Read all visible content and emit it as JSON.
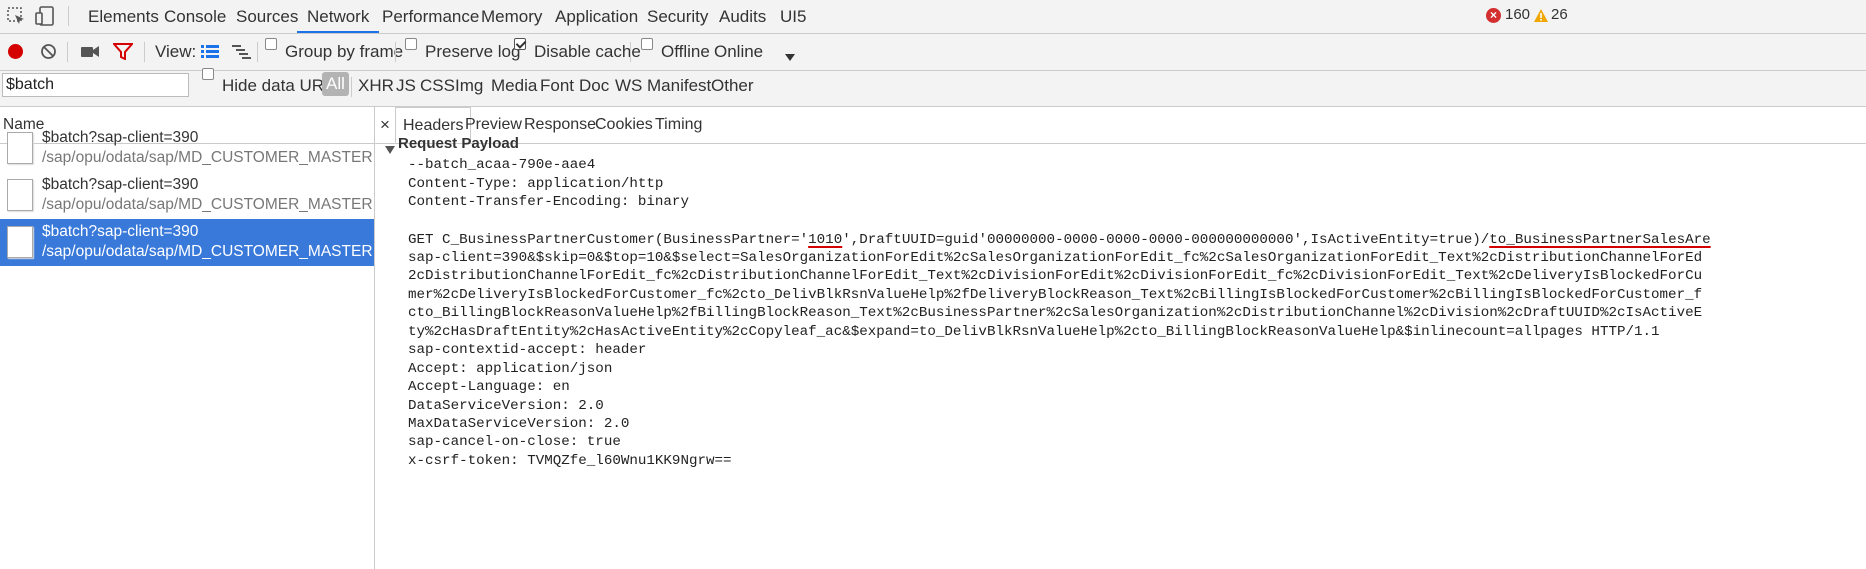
{
  "topbar": {
    "tabs": [
      "Elements",
      "Console",
      "Sources",
      "Network",
      "Performance",
      "Memory",
      "Application",
      "Security",
      "Audits",
      "UI5"
    ],
    "active_tab": "Network",
    "error_count": "160",
    "warning_count": "26"
  },
  "toolbar": {
    "view_label": "View:",
    "group_by_frame": "Group by frame",
    "preserve_log": "Preserve log",
    "disable_cache": "Disable cache",
    "offline": "Offline",
    "throttle_value": "Online"
  },
  "filterbar": {
    "filter_value": "$batch",
    "hide_data_urls": "Hide data URLs",
    "types": [
      "All",
      "XHR",
      "JS",
      "CSS",
      "Img",
      "Media",
      "Font",
      "Doc",
      "WS",
      "Manifest",
      "Other"
    ]
  },
  "requests": {
    "header": "Name",
    "items": [
      {
        "name": "$batch?sap-client=390",
        "path": "/sap/opu/odata/sap/MD_CUSTOMER_MASTER_SRV..."
      },
      {
        "name": "$batch?sap-client=390",
        "path": "/sap/opu/odata/sap/MD_CUSTOMER_MASTER_SRV..."
      },
      {
        "name": "$batch?sap-client=390",
        "path": "/sap/opu/odata/sap/MD_CUSTOMER_MASTER_SRV..."
      }
    ]
  },
  "details": {
    "close": "×",
    "tabs": [
      "Headers",
      "Preview",
      "Response",
      "Cookies",
      "Timing"
    ],
    "active_tab": "Headers",
    "section_title": "Request Payload",
    "payload": {
      "l1": "--batch_acaa-790e-aae4",
      "l2": "Content-Type: application/http",
      "l3": "Content-Transfer-Encoding: binary",
      "get_prefix": "GET C_BusinessPartnerCustomer(BusinessPartner='",
      "get_key": "1010",
      "get_mid": "',DraftUUID=guid'00000000-0000-0000-0000-000000000000',IsActiveEntity=true)/",
      "get_nav": "to_BusinessPartnerSalesAre",
      "l5": "sap-client=390&$skip=0&$top=10&$select=SalesOrganizationForEdit%2cSalesOrganizationForEdit_fc%2cSalesOrganizationForEdit_Text%2cDistributionChannelForEd",
      "l6": "2cDistributionChannelForEdit_fc%2cDistributionChannelForEdit_Text%2cDivisionForEdit%2cDivisionForEdit_fc%2cDivisionForEdit_Text%2cDeliveryIsBlockedForCu",
      "l7": "mer%2cDeliveryIsBlockedForCustomer_fc%2cto_DelivBlkRsnValueHelp%2fDeliveryBlockReason_Text%2cBillingIsBlockedForCustomer%2cBillingIsBlockedForCustomer_f",
      "l8": "cto_BillingBlockReasonValueHelp%2fBillingBlockReason_Text%2cBusinessPartner%2cSalesOrganization%2cDistributionChannel%2cDivision%2cDraftUUID%2cIsActiveE",
      "l9": "ty%2cHasDraftEntity%2cHasActiveEntity%2cCopyleaf_ac&$expand=to_DelivBlkRsnValueHelp%2cto_BillingBlockReasonValueHelp&$inlinecount=allpages HTTP/1.1",
      "l10": "sap-contextid-accept: header",
      "l11": "Accept: application/json",
      "l12": "Accept-Language: en",
      "l13": "DataServiceVersion: 2.0",
      "l14": "MaxDataServiceVersion: 2.0",
      "l15": "sap-cancel-on-close: true",
      "l16": "x-csrf-token: TVMQZfe_l60Wnu1KK9Ngrw=="
    }
  },
  "colors": {
    "accent": "#1a73e8",
    "selection": "#3879d9",
    "record": "#d50000",
    "filter": "#d50000",
    "error": "#d32f2f",
    "warning": "#f2a600"
  }
}
